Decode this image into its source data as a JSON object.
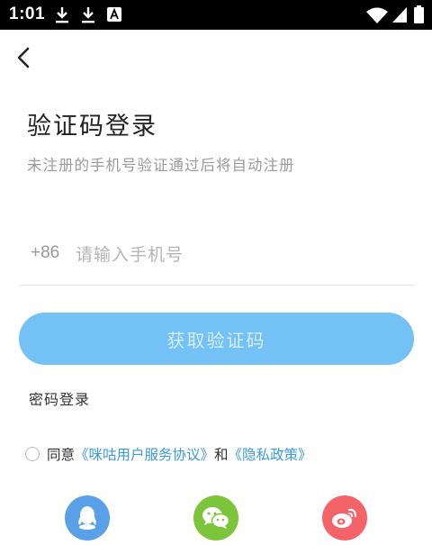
{
  "status_bar": {
    "time": "1:01",
    "left_icons": [
      "download-icon",
      "download-icon",
      "keyboard-a-icon"
    ],
    "right_icons": [
      "wifi-icon",
      "signal-icon",
      "battery-icon"
    ]
  },
  "header": {
    "back_icon": "chevron-left-icon"
  },
  "login": {
    "title": "验证码登录",
    "subtitle": "未注册的手机号验证通过后将自动注册",
    "phone_prefix": "+86",
    "phone_value": "",
    "phone_placeholder": "请输入手机号",
    "get_code_label": "获取验证码",
    "password_login_label": "密码登录"
  },
  "agreement": {
    "checked": false,
    "agree_text": "同意",
    "user_agreement": "《咪咕用户服务协议》",
    "and_text": "和",
    "privacy_policy": "《隐私政策》"
  },
  "social": [
    {
      "name": "qq",
      "icon": "qq-icon",
      "color": "#5aa0e8"
    },
    {
      "name": "wechat",
      "icon": "wechat-icon",
      "color": "#7cc43a"
    },
    {
      "name": "weibo",
      "icon": "weibo-icon",
      "color": "#f4636a"
    }
  ],
  "colors": {
    "button_bg": "#73c1f5",
    "button_text": "#d6edfd",
    "link": "#3a9be0"
  }
}
